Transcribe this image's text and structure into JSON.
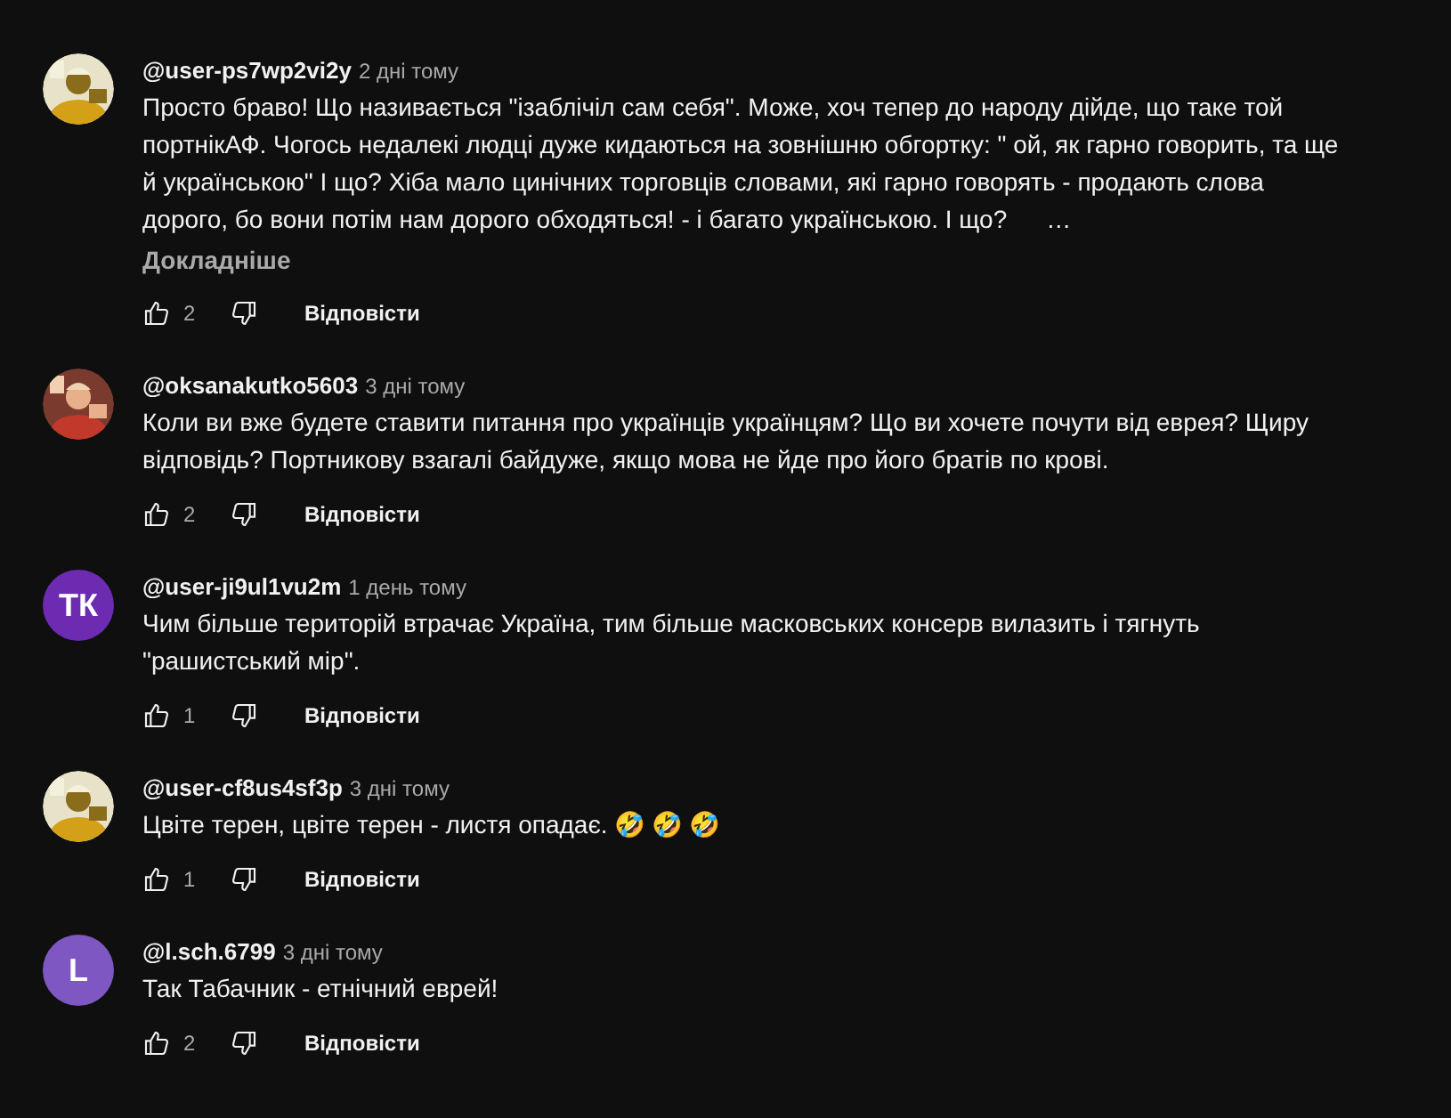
{
  "comments": [
    {
      "author": "@user-ps7wp2vi2y",
      "time": "2 дні тому",
      "avatar": {
        "kind": "picture"
      },
      "lines": [
        "Просто браво! Що називається  \"ізаблічіл сам себя\". Може, хоч тепер до народу дійде, що таке той",
        "портнікАФ.  Чогось недалекі людці дуже кидаються на зовнішню обгортку: \" ой, як гарно говорить, та ще",
        "й українською\" І що? Хіба мало цинічних торговців словами, які гарно говорять - продають слова",
        "дорого, бо вони потім нам дорого обходяться! - і багато українською. І що?"
      ],
      "ellipsis": "…",
      "more": "Докладніше",
      "likes": "2",
      "reply": "Відповісти"
    },
    {
      "author": "@oksanakutko5603",
      "time": "3 дні тому",
      "avatar": {
        "kind": "picture"
      },
      "lines": [
        "Коли ви вже будете ставити питання про українців українцям? Що ви хочете почути від еврея? Щиру",
        "відповідь? Портникову взагалі байдуже, якщо мова не йде про його братів по крові."
      ],
      "likes": "2",
      "reply": "Відповісти"
    },
    {
      "author": "@user-ji9ul1vu2m",
      "time": "1 день тому",
      "avatar": {
        "kind": "letter",
        "text": "ТК",
        "color": "#6c2bb0"
      },
      "lines": [
        "Чим більше територій втрачає Україна, тим більше масковських консерв вилазить і тягнуть",
        "\"рашистський мір\"."
      ],
      "likes": "1",
      "reply": "Відповісти"
    },
    {
      "author": "@user-cf8us4sf3p",
      "time": "3 дні тому",
      "avatar": {
        "kind": "picture"
      },
      "lines": [
        "Цвіте терен, цвіте терен - листя опадає. 🤣 🤣 🤣"
      ],
      "likes": "1",
      "reply": "Відповісти"
    },
    {
      "author": "@l.sch.6799",
      "time": "3 дні тому",
      "avatar": {
        "kind": "letter",
        "text": "L",
        "color": "#7e57c2"
      },
      "lines": [
        "Так Табачник - етнічний еврей!"
      ],
      "likes": "2",
      "reply": "Відповісти"
    }
  ]
}
